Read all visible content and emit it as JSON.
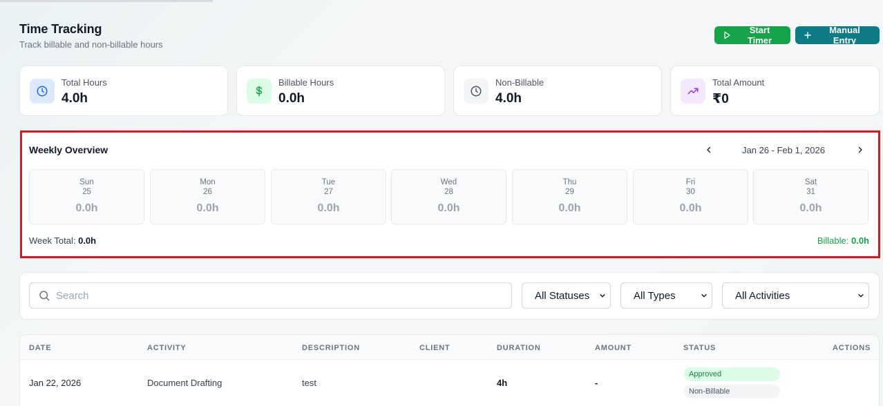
{
  "header": {
    "title": "Time Tracking",
    "subtitle": "Track billable and non-billable hours"
  },
  "actions": {
    "start_timer": "Start Timer",
    "manual_entry": "Manual Entry"
  },
  "stats": [
    {
      "label": "Total Hours",
      "value": "4.0h",
      "icon": "clock-icon",
      "color": "#2563eb",
      "bg": "#dbeafe"
    },
    {
      "label": "Billable Hours",
      "value": "0.0h",
      "icon": "dollar-icon",
      "color": "#16a34a",
      "bg": "#dcfce7"
    },
    {
      "label": "Non-Billable",
      "value": "4.0h",
      "icon": "clock-icon",
      "color": "#4b5563",
      "bg": "#f3f4f6"
    },
    {
      "label": "Total Amount",
      "value": "₹0",
      "icon": "trending-up-icon",
      "color": "#9333ea",
      "bg": "#f3e8ff"
    }
  ],
  "weekly": {
    "title": "Weekly Overview",
    "date_range": "Jan 26 - Feb 1, 2026",
    "days": [
      {
        "name": "Sun",
        "date": "25",
        "hours": "0.0h"
      },
      {
        "name": "Mon",
        "date": "26",
        "hours": "0.0h"
      },
      {
        "name": "Tue",
        "date": "27",
        "hours": "0.0h"
      },
      {
        "name": "Wed",
        "date": "28",
        "hours": "0.0h"
      },
      {
        "name": "Thu",
        "date": "29",
        "hours": "0.0h"
      },
      {
        "name": "Fri",
        "date": "30",
        "hours": "0.0h"
      },
      {
        "name": "Sat",
        "date": "31",
        "hours": "0.0h"
      }
    ],
    "week_total_label": "Week Total:",
    "week_total_value": "0.0h",
    "billable_label": "Billable:",
    "billable_value": "0.0h"
  },
  "filters": {
    "search_placeholder": "Search",
    "status": "All Statuses",
    "type": "All Types",
    "activity": "All Activities"
  },
  "table": {
    "columns": [
      "DATE",
      "ACTIVITY",
      "DESCRIPTION",
      "CLIENT",
      "DURATION",
      "AMOUNT",
      "STATUS",
      "ACTIONS"
    ],
    "rows": [
      {
        "date": "Jan 22, 2026",
        "activity": "Document Drafting",
        "description": "test",
        "client": "",
        "duration": "4h",
        "amount": "-",
        "status": "Approved",
        "billing": "Non-Billable"
      }
    ]
  },
  "colors": {
    "primary_green": "#16a34a",
    "primary_teal": "#0e7c86",
    "highlight_red": "#e3121f"
  }
}
